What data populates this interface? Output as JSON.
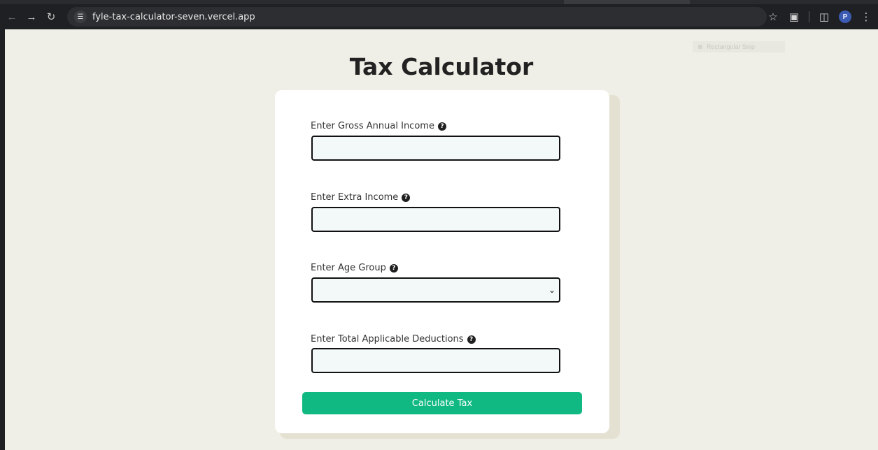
{
  "browser": {
    "url": "fyle-tax-calculator-seven.vercel.app",
    "profile_initial": "P",
    "icons": {
      "back": "arrow-left-icon",
      "forward": "arrow-right-icon",
      "reload": "reload-icon",
      "site_info": "tune-icon",
      "bookmark": "star-icon",
      "extensions": "puzzle-icon",
      "side_panel": "side-panel-icon",
      "menu": "kebab-menu-icon"
    }
  },
  "overlay": {
    "snip_label": "Rectangular Snip"
  },
  "page": {
    "title": "Tax Calculator"
  },
  "form": {
    "gross_income": {
      "label": "Enter Gross Annual Income",
      "value": ""
    },
    "extra_income": {
      "label": "Enter Extra Income",
      "value": ""
    },
    "age_group": {
      "label": "Enter Age Group",
      "selected": ""
    },
    "deductions": {
      "label": "Enter Total Applicable Deductions",
      "value": ""
    },
    "submit_label": "Calculate Tax"
  },
  "colors": {
    "page_bg": "#f0efe7",
    "card_bg": "#ffffff",
    "input_bg": "#f3f9f9",
    "button_bg": "#10b981",
    "chrome_bg": "#1f2023"
  }
}
